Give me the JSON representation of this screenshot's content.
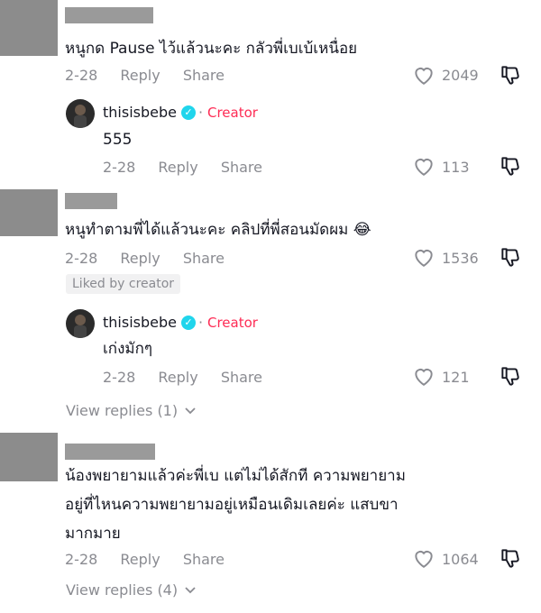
{
  "comments": [
    {
      "text": [
        "หนูกด Pause ไว้แล้วนะคะ กลัวพี่เบเบ้เหนื่อย"
      ],
      "date": "2-28",
      "reply_label": "Reply",
      "share_label": "Share",
      "likes": "2049",
      "reply": {
        "username": "thisisbebe",
        "badge": "Creator",
        "text": "555",
        "date": "2-28",
        "reply_label": "Reply",
        "share_label": "Share",
        "likes": "113"
      }
    },
    {
      "text": [
        "หนูทำตามพี่ได้แล้วนะคะ คลิปที่พี่สอนมัดผม 😂"
      ],
      "date": "2-28",
      "reply_label": "Reply",
      "share_label": "Share",
      "likes": "1536",
      "liked_by": "Liked by creator",
      "reply": {
        "username": "thisisbebe",
        "badge": "Creator",
        "text": "เก่งมักๆ",
        "date": "2-28",
        "reply_label": "Reply",
        "share_label": "Share",
        "likes": "121"
      },
      "view_replies": "View replies (1)"
    },
    {
      "text": [
        "น้องพยายามแล้วค่ะพี่เบ แต่ไม่ได้สักที ความพยายาม",
        "อยู่ที่ไหนความพยายามอยู่เหมือนเดิมเลยค่ะ แสบขา",
        "มากมาย"
      ],
      "date": "2-28",
      "reply_label": "Reply",
      "share_label": "Share",
      "likes": "1064",
      "view_replies": "View replies (4)"
    }
  ],
  "icons": {
    "like": "heart-outline-icon",
    "dislike": "thumbs-down-icon",
    "verified": "verified-check-icon",
    "expand": "chevron-down-icon"
  },
  "colors": {
    "creator": "#fe2c55",
    "verified": "#20d5ec",
    "muted": "#8a8b91"
  }
}
